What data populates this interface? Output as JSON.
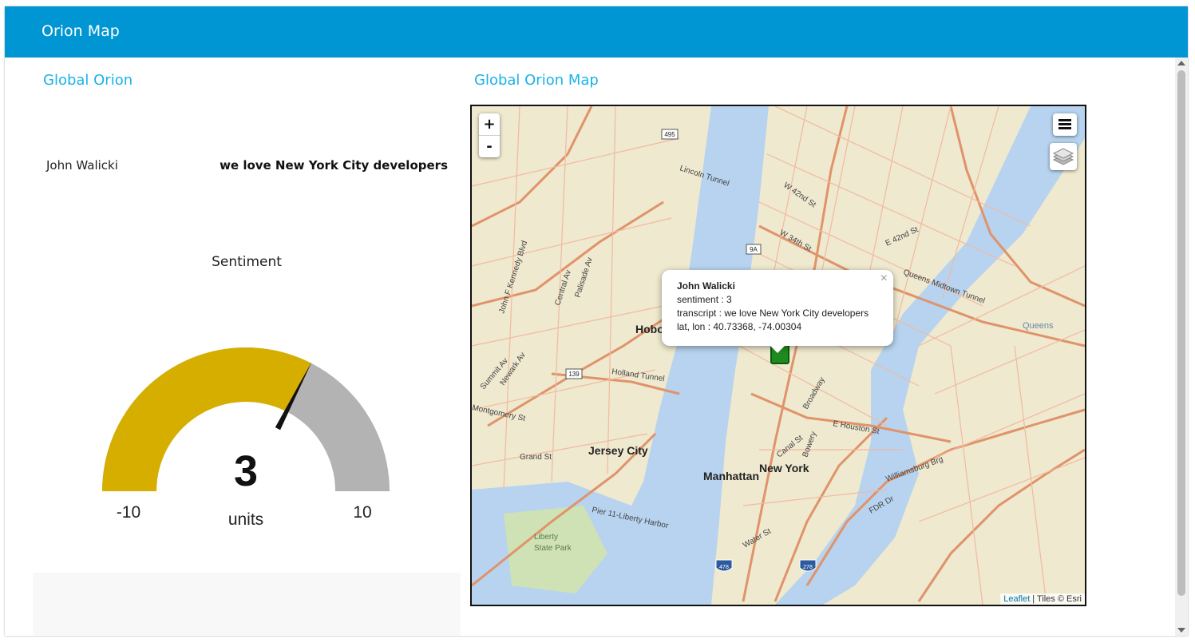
{
  "app": {
    "title": "Orion Map"
  },
  "left": {
    "heading": "Global Orion",
    "row": {
      "name": "John Walicki",
      "transcript": "we love New York City developers"
    },
    "gauge": {
      "label": "Sentiment",
      "value": "3",
      "value_numeric": 3,
      "units": "units",
      "min": "-10",
      "max": "10",
      "min_numeric": -10,
      "max_numeric": 10,
      "fill_color": "#d6ae00",
      "track_color": "#b3b3b3"
    }
  },
  "right": {
    "heading": "Global Orion Map",
    "map": {
      "zoom_in": "+",
      "zoom_out": "-",
      "popup": {
        "name": "John Walicki",
        "sentiment": "sentiment : 3",
        "transcript": "transcript : we love New York City developers",
        "latlon": "lat, lon : 40.73368, -74.00304",
        "close": "×"
      },
      "labels": {
        "jersey_city": "Jersey City",
        "manhattan": "Manhattan",
        "new_york": "New York",
        "hoboken": "Hobok",
        "liberty": "Liberty",
        "state_park": "State Park",
        "queens": "Queens"
      },
      "streets": {
        "lincoln_tunnel": "Lincoln Tunnel",
        "holland_tunnel": "Holland Tunnel",
        "queens_midtown": "Queens Midtown Tunnel",
        "williamsburg": "Williamsburg Brg",
        "e_houston": "E Houston St",
        "broadway": "Broadway",
        "grand_st": "Grand St",
        "montgomery": "Montgomery St",
        "w42": "W 42nd St",
        "w34": "W 34th St",
        "e42": "E 42nd St",
        "fdr": "FDR Dr",
        "canal": "Canal St",
        "bowery": "Bowery",
        "kennedy": "John F Kennedy Blvd",
        "palisade": "Palisade Av",
        "central": "Central Av",
        "summit": "Summit Av",
        "newark": "Newark Av",
        "pier11": "Pier 11-Liberty Harbor",
        "water": "Water St",
        "rt139": "139",
        "rt495": "495",
        "rt9a": "9A",
        "rt478": "478",
        "rt278": "278"
      },
      "attribution": {
        "leaflet": "Leaflet",
        "tiles": " | Tiles © Esri"
      }
    }
  },
  "colors": {
    "header_bg": "#0095d3",
    "heading": "#1ab2e8",
    "water": "#b7d3ef",
    "land": "#eee9cf",
    "road_major": "#e0936a",
    "road_minor": "#f2b9a0",
    "park": "#cfe2b5",
    "marker": "#1f8a1f"
  }
}
